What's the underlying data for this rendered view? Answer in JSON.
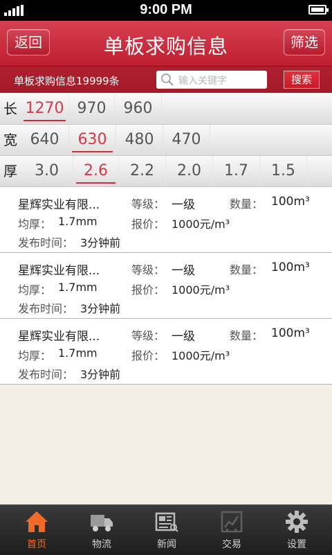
{
  "status": {
    "time": "9:00 PM"
  },
  "header": {
    "back_label": "返回",
    "title": "单板求购信息",
    "filter_label": "筛选"
  },
  "search": {
    "count_text": "单板求购信息19999条",
    "placeholder": "输入关键字",
    "button_label": "搜索"
  },
  "filters": {
    "length": {
      "label": "长",
      "options": [
        "1270",
        "970",
        "960"
      ],
      "selected": 0
    },
    "width": {
      "label": "宽",
      "options": [
        "640",
        "630",
        "480",
        "470"
      ],
      "selected": 1
    },
    "thickness": {
      "label": "厚",
      "options": [
        "3.0",
        "2.6",
        "2.2",
        "2.0",
        "1.7",
        "1.5"
      ],
      "selected": 1
    }
  },
  "listing_labels": {
    "grade": "等级：",
    "quantity": "数量：",
    "thickness": "均厚：",
    "price": "报价：",
    "time": "发布时间："
  },
  "listings": [
    {
      "company": "星辉实业有限...",
      "grade": "一级",
      "quantity": "100m³",
      "thickness": "1.7mm",
      "price": "1000元/m³",
      "time": "3分钟前"
    },
    {
      "company": "星辉实业有限...",
      "grade": "一级",
      "quantity": "100m³",
      "thickness": "1.7mm",
      "price": "1000元/m³",
      "time": "3分钟前"
    },
    {
      "company": "星辉实业有限...",
      "grade": "一级",
      "quantity": "100m³",
      "thickness": "1.7mm",
      "price": "1000元/m³",
      "time": "3分钟前"
    }
  ],
  "tabs": [
    {
      "label": "首页",
      "icon": "home-icon",
      "active": true
    },
    {
      "label": "物流",
      "icon": "truck-icon",
      "active": false
    },
    {
      "label": "新闻",
      "icon": "newspaper-icon",
      "active": false
    },
    {
      "label": "交易",
      "icon": "trade-chart-icon",
      "active": false
    },
    {
      "label": "设置",
      "icon": "gear-icon",
      "active": false
    }
  ],
  "colors": {
    "accent": "#c7303b",
    "active_tab": "#f26a2a"
  }
}
